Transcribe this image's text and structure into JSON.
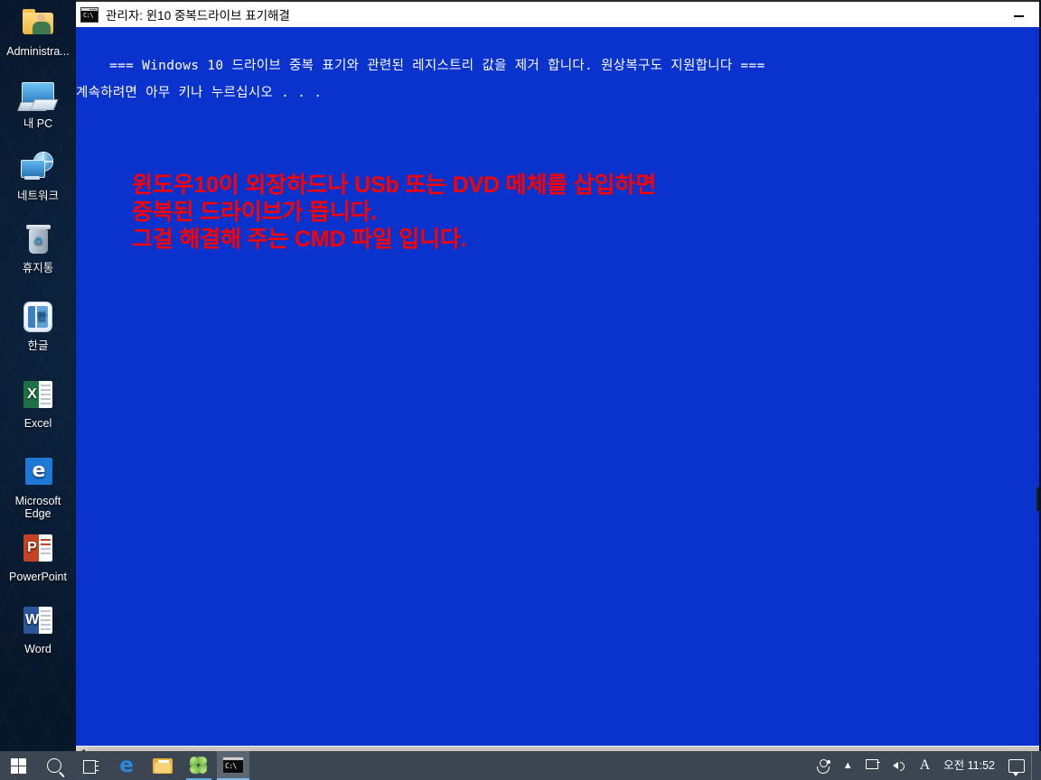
{
  "desktop": {
    "icons": [
      {
        "label": "Administra...",
        "icon": "user-folder-icon"
      },
      {
        "label": "내 PC",
        "icon": "this-pc-icon"
      },
      {
        "label": "네트워크",
        "icon": "network-icon"
      },
      {
        "label": "휴지통",
        "icon": "recycle-bin-icon"
      },
      {
        "label": "한글",
        "icon": "hangul-word-processor-icon"
      },
      {
        "label": "Excel",
        "icon": "excel-icon"
      },
      {
        "label": "Microsoft Edge",
        "icon": "edge-icon"
      },
      {
        "label": "PowerPoint",
        "icon": "powerpoint-icon"
      },
      {
        "label": "Word",
        "icon": "word-icon"
      }
    ]
  },
  "console_window": {
    "title": "관리자:  윈10 중복드라이브 표기해결",
    "icon": "cmd-icon",
    "icon_text": "C:\\",
    "minimize_label": "—",
    "background_color": "#0a32cc",
    "text_color": "#ffffff",
    "lines": [
      "=== Windows 10 드라이브 중복 표기와 관련된 레지스트리 값을 제거 합니다. 원상복구도 지원합니다 ===",
      "계속하려면 아무 키나 누르십시오 . . ."
    ],
    "overlay_text": {
      "color": "#ff0000",
      "lines": [
        "윈도우10이 외장하드나 USb 또는 DVD 메체를 삽입하면",
        "중복된 드라이브가 뜹니다.",
        "그걸 해결해 주는 CMD 파일 입니다."
      ]
    }
  },
  "taskbar": {
    "background_color": "#3b4652",
    "buttons": [
      {
        "name": "start-button",
        "icon": "windows-logo-icon",
        "label": "시작"
      },
      {
        "name": "search-button",
        "icon": "search-icon",
        "label": "검색"
      },
      {
        "name": "task-view-button",
        "icon": "task-view-icon",
        "label": "작업 보기"
      },
      {
        "name": "edge-button",
        "icon": "edge-icon",
        "label": "Microsoft Edge"
      },
      {
        "name": "file-explorer-button",
        "icon": "folder-icon",
        "label": "파일 탐색기"
      },
      {
        "name": "clover-app-button",
        "icon": "clover-icon",
        "label": "클로버"
      },
      {
        "name": "cmd-taskbar-button",
        "icon": "cmd-icon",
        "label": "관리자: 윈10 중복드라이브 표기해결"
      }
    ],
    "tray": {
      "people_label": "사람",
      "chevron_label": "︿",
      "network_label": "네트워크",
      "volume_label": "볼륨",
      "ime_label": "A",
      "clock": "오전 11:52",
      "notification_label": "알림 센터"
    }
  }
}
